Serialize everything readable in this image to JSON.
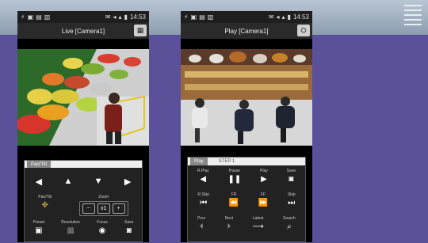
{
  "left_phone": {
    "status": {
      "time": "14:53"
    },
    "title": "Live [Camera1]",
    "menu_icon": "grid-icon",
    "panel": {
      "tab": "Pan/Tilt",
      "arrows": [
        "◀",
        "▲",
        "▼",
        "▶"
      ],
      "labels": {
        "pantilt": "Pan/Tilt",
        "zoom": "Zoom",
        "preset": "Preset",
        "resolution": "Resolution",
        "focus": "Focus",
        "save": "Save"
      },
      "zoom": {
        "minus": "−",
        "x1": "x1",
        "plus": "+"
      }
    }
  },
  "right_phone": {
    "status": {
      "time": "14:53"
    },
    "title": "Play [Camera1]",
    "panel": {
      "tabs": [
        "Play",
        "STEP 1"
      ],
      "row1": {
        "rplay": "R.Play",
        "pause": "Pause",
        "play": "Play",
        "save": "Save"
      },
      "row2": {
        "rskip": "R.Skip",
        "fr": "FR",
        "ff": "FF",
        "skip": "Skip"
      },
      "row3": {
        "prev": "Prev",
        "next": "Next",
        "latest": "Latest",
        "search": "Search"
      }
    }
  }
}
